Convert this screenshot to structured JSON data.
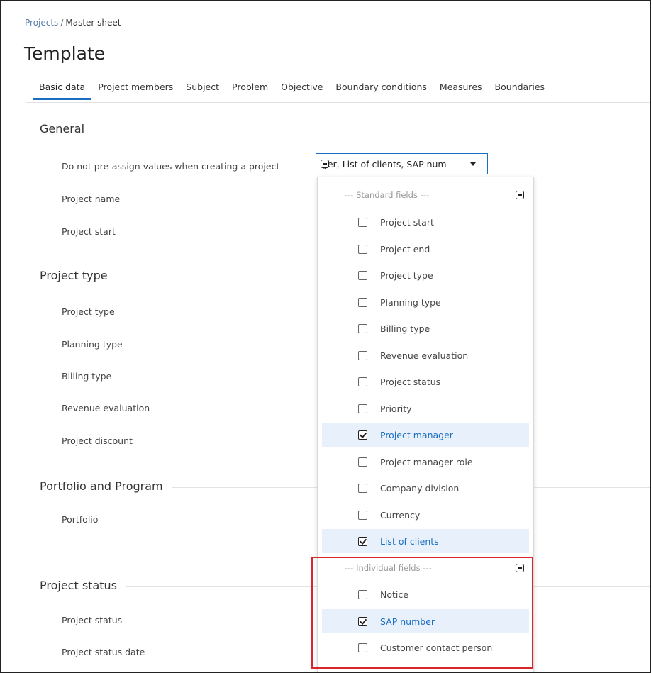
{
  "breadcrumb": {
    "parent": "Projects",
    "separator": "/",
    "current": "Master sheet"
  },
  "page_title": "Template",
  "tabs": [
    "Basic data",
    "Project members",
    "Subject",
    "Problem",
    "Objective",
    "Boundary conditions",
    "Measures",
    "Boundaries"
  ],
  "sections": {
    "general": {
      "title": "General",
      "fields": [
        "Do not pre-assign values when creating a project",
        "Project name",
        "Project start"
      ]
    },
    "project_type": {
      "title": "Project type",
      "fields": [
        "Project type",
        "Planning type",
        "Billing type",
        "Revenue evaluation",
        "Project discount"
      ]
    },
    "portfolio": {
      "title": "Portfolio and Program",
      "fields": [
        "Portfolio"
      ]
    },
    "project_status": {
      "title": "Project status",
      "fields": [
        "Project status",
        "Project status date"
      ]
    }
  },
  "select": {
    "value": "ger, List of clients, SAP num"
  },
  "dropdown": {
    "standard_header": "--- Standard fields ---",
    "individual_header": "--- Individual fields ---",
    "standard_options": [
      {
        "label": "Project start",
        "checked": false
      },
      {
        "label": "Project end",
        "checked": false
      },
      {
        "label": "Project type",
        "checked": false
      },
      {
        "label": "Planning type",
        "checked": false
      },
      {
        "label": "Billing type",
        "checked": false
      },
      {
        "label": "Revenue evaluation",
        "checked": false
      },
      {
        "label": "Project status",
        "checked": false
      },
      {
        "label": "Priority",
        "checked": false
      },
      {
        "label": "Project manager",
        "checked": true
      },
      {
        "label": "Project manager role",
        "checked": false
      },
      {
        "label": "Company division",
        "checked": false
      },
      {
        "label": "Currency",
        "checked": false
      },
      {
        "label": "List of clients",
        "checked": true
      }
    ],
    "individual_options": [
      {
        "label": "Notice",
        "checked": false
      },
      {
        "label": "SAP number",
        "checked": true
      },
      {
        "label": "Customer contact person",
        "checked": false
      }
    ]
  },
  "colors": {
    "accent": "#1b6ec2",
    "highlight_border": "#d9262b",
    "checked_row_bg": "#e8f1fb"
  }
}
